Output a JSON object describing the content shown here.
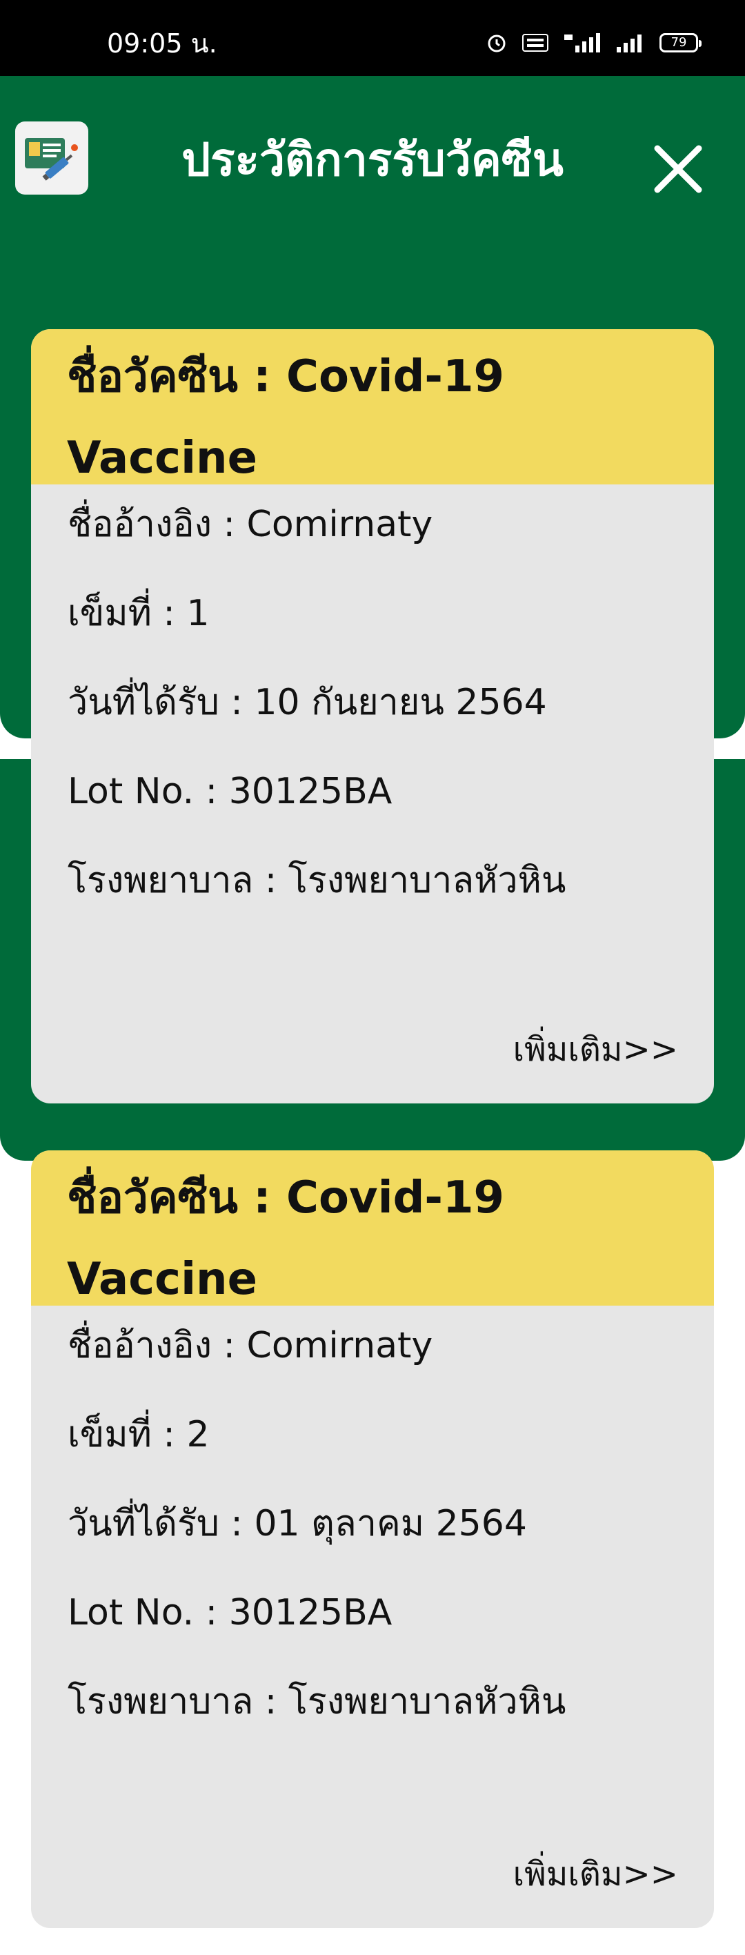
{
  "status_bar": {
    "time": "09:05 น.",
    "battery": "79"
  },
  "header": {
    "title": "ประวัติการรับวัคซีน"
  },
  "colors": {
    "header_green": "#006b3a",
    "card_header_yellow": "#f2da5f",
    "card_body_gray": "#e6e6e6"
  },
  "icons": {
    "app": "vaccine-certificate-icon",
    "close": "close-icon"
  },
  "cards": [
    {
      "title": "ชื่อวัคซีน : Covid-19 Vaccine",
      "fields": [
        {
          "label": "ชื่ออ้างอิง",
          "value": "Comirnaty"
        },
        {
          "label": "เข็มที่",
          "value": "1"
        },
        {
          "label": "วันที่ได้รับ",
          "value": "10 กันยายน 2564"
        },
        {
          "label": "Lot No.",
          "value": "30125BA"
        },
        {
          "label": "โรงพยาบาล",
          "value": "โรงพยาบาลหัวหิน"
        }
      ],
      "more_label": "เพิ่มเติม>>"
    },
    {
      "title": "ชื่อวัคซีน : Covid-19 Vaccine",
      "fields": [
        {
          "label": "ชื่ออ้างอิง",
          "value": "Comirnaty"
        },
        {
          "label": "เข็มที่",
          "value": "2"
        },
        {
          "label": "วันที่ได้รับ",
          "value": "01 ตุลาคม 2564"
        },
        {
          "label": "Lot No.",
          "value": "30125BA"
        },
        {
          "label": "โรงพยาบาล",
          "value": "โรงพยาบาลหัวหิน"
        }
      ],
      "more_label": "เพิ่มเติม>>"
    }
  ]
}
